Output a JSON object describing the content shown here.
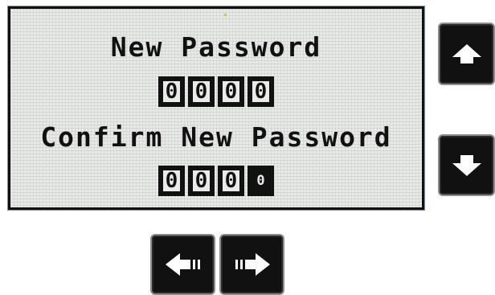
{
  "display": {
    "title": "New Password",
    "password_digits": [
      "0",
      "0",
      "0",
      "0"
    ],
    "confirm_title": "Confirm New Password",
    "confirm_digits": [
      "0",
      "0",
      "0",
      "0"
    ]
  },
  "buttons": {
    "up": {
      "icon": "arrow-up-icon"
    },
    "down": {
      "icon": "arrow-down-icon"
    },
    "left": {
      "icon": "arrow-left-icon"
    },
    "right": {
      "icon": "arrow-right-icon"
    }
  },
  "colors": {
    "screen_background": "#e9ebe8",
    "screen_ink": "#111111",
    "button_face": "#111111",
    "button_border": "#8d8d8d"
  }
}
